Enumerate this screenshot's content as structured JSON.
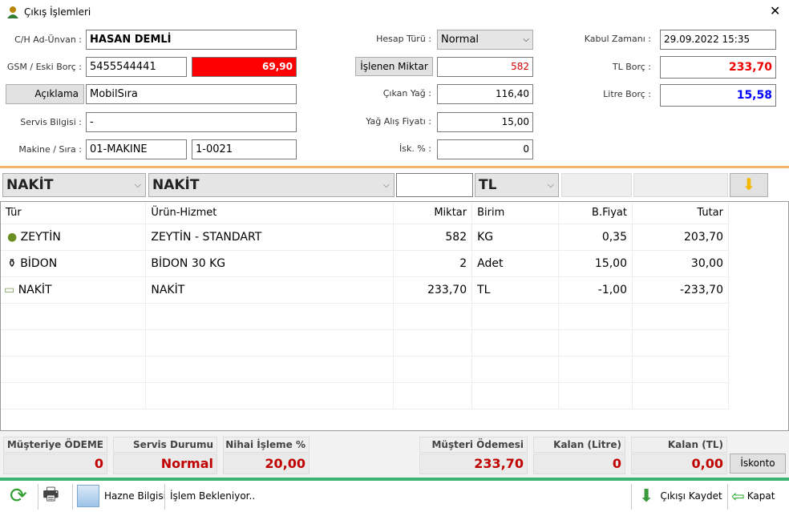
{
  "window": {
    "title": "Çıkış İşlemleri"
  },
  "form": {
    "ch_label": "C/H Ad-Ünvan :",
    "ch_value": "HASAN DEMLİ",
    "gsm_label": "GSM / Eski Borç :",
    "gsm_value": "5455544441",
    "eski_borc": "69,90",
    "aciklama_button": "Açıklama",
    "aciklama_value": "MobilSıra",
    "servis_label": "Servis Bilgisi :",
    "servis_value": "-",
    "makine_label": "Makine / Sıra :",
    "makine_value": "01-MAKINE",
    "sira_value": "1-0021",
    "hesap_label": "Hesap Türü :",
    "hesap_value": "Normal",
    "islenen_button": "İşlenen Miktar",
    "islenen_value": "582",
    "cikan_label": "Çıkan Yağ :",
    "cikan_value": "116,40",
    "alis_label": "Yağ Alış Fiyatı :",
    "alis_value": "15,00",
    "isk_label": "İsk. % :",
    "isk_value": "0",
    "kabul_label": "Kabul Zamanı :",
    "kabul_value": "29.09.2022 15:35",
    "tl_label": "TL Borç :",
    "tl_value": "233,70",
    "litre_label": "Litre Borç :",
    "litre_value": "15,58"
  },
  "entry": {
    "type": "NAKİT",
    "product": "NAKİT",
    "qty": "",
    "unit": "TL"
  },
  "grid": {
    "headers": [
      "Tür",
      "Ürün-Hizmet",
      "Miktar",
      "Birim",
      "B.Fiyat",
      "Tutar"
    ],
    "rows": [
      {
        "icon": "olive-icon",
        "type": "ZEYTİN",
        "product": "ZEYTİN - STANDART",
        "qty": "582",
        "unit": "KG",
        "price": "0,35",
        "total": "203,70"
      },
      {
        "icon": "bottle-icon",
        "type": "BİDON",
        "product": "BİDON 30 KG",
        "qty": "2",
        "unit": "Adet",
        "price": "15,00",
        "total": "30,00"
      },
      {
        "icon": "cash-icon",
        "type": "NAKİT",
        "product": "NAKİT",
        "qty": "233,70",
        "unit": "TL",
        "price": "-1,00",
        "total": "-233,70"
      }
    ]
  },
  "summary": {
    "musteriye_label": "Müşteriye ÖDEME",
    "musteriye_value": "0",
    "servis_label": "Servis Durumu",
    "servis_value": "Normal",
    "nihai_label": "Nihai İşleme %",
    "nihai_value": "20,00",
    "odemesi_label": "Müşteri Ödemesi",
    "odemesi_value": "233,70",
    "kalan_litre_label": "Kalan (Litre)",
    "kalan_litre_value": "0",
    "kalan_tl_label": "Kalan (TL)",
    "kalan_tl_value": "0,00",
    "iskonto_button": "İskonto"
  },
  "toolbar": {
    "hazne": "Hazne Bilgisi",
    "status": "İşlem Bekleniyor..",
    "kaydet": "Çıkışı Kaydet",
    "kapat": "Kapat"
  },
  "colors": {
    "accent_orange": "#f7b36b",
    "accent_green": "#3cb371",
    "debt_red": "#ff0000",
    "value_red": "#c00000",
    "litre_blue": "#0000ff"
  }
}
